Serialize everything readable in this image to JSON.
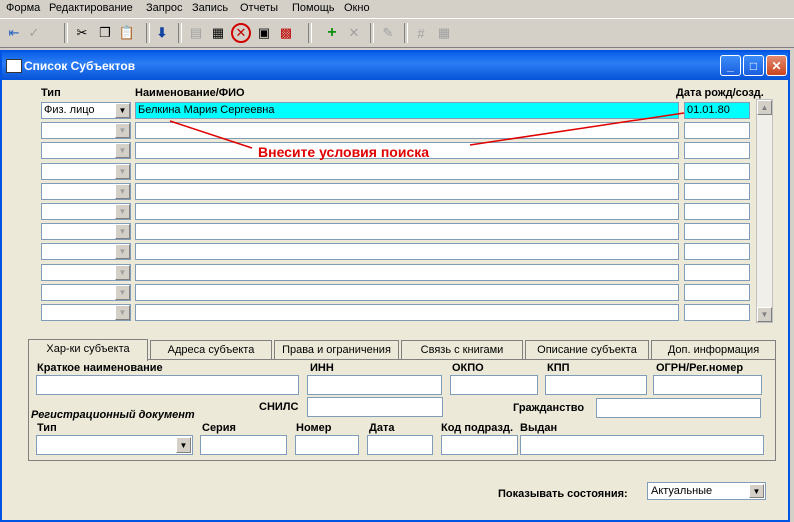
{
  "menu": {
    "items": [
      {
        "label": "Форма"
      },
      {
        "label": "Редактирование"
      },
      {
        "label": "Запрос"
      },
      {
        "label": "Запись"
      },
      {
        "label": "Отчеты"
      },
      {
        "label": "Помощь"
      },
      {
        "label": "Окно"
      }
    ]
  },
  "window": {
    "title": "Список Субъектов"
  },
  "grid": {
    "headers": {
      "type": "Тип",
      "name": "Наименование/ФИО",
      "date": "Дата рожд/созд."
    },
    "rows": [
      {
        "type": "Физ. лицо",
        "name": "Белкина Мария  Сергеевна",
        "date": "01.01.80"
      },
      {
        "type": "",
        "name": "",
        "date": ""
      },
      {
        "type": "",
        "name": "",
        "date": ""
      },
      {
        "type": "",
        "name": "",
        "date": ""
      },
      {
        "type": "",
        "name": "",
        "date": ""
      },
      {
        "type": "",
        "name": "",
        "date": ""
      },
      {
        "type": "",
        "name": "",
        "date": ""
      },
      {
        "type": "",
        "name": "",
        "date": ""
      },
      {
        "type": "",
        "name": "",
        "date": ""
      },
      {
        "type": "",
        "name": "",
        "date": ""
      },
      {
        "type": "",
        "name": "",
        "date": ""
      }
    ]
  },
  "annotation": {
    "text": "Внесите условия поиска",
    "color": "#e00000"
  },
  "tabs": [
    {
      "label": "Хар-ки субъекта",
      "active": true
    },
    {
      "label": "Адреса субъекта",
      "active": false
    },
    {
      "label": "Права и ограничения",
      "active": false
    },
    {
      "label": "Связь с книгами",
      "active": false
    },
    {
      "label": "Описание субъекта",
      "active": false
    },
    {
      "label": "Доп. информация",
      "active": false
    }
  ],
  "form": {
    "short_name": "Краткое наименование",
    "inn": "ИНН",
    "okpo": "ОКПО",
    "kpp": "КПП",
    "ogrn": "ОГРН/Рег.номер",
    "snils": "СНИЛС",
    "citizenship": "Гражданство",
    "reg_doc": "Регистрационный документ",
    "doc_type": "Тип",
    "series": "Серия",
    "number": "Номер",
    "date": "Дата",
    "dept_code": "Код подразд.",
    "issued": "Выдан"
  },
  "footer": {
    "states_label": "Показывать состояния:",
    "states_value": "Актуальные"
  },
  "colors": {
    "title_bar": "#0a5fe8",
    "highlight_row": "#00ffff",
    "window_bg": "#ece9d8"
  }
}
